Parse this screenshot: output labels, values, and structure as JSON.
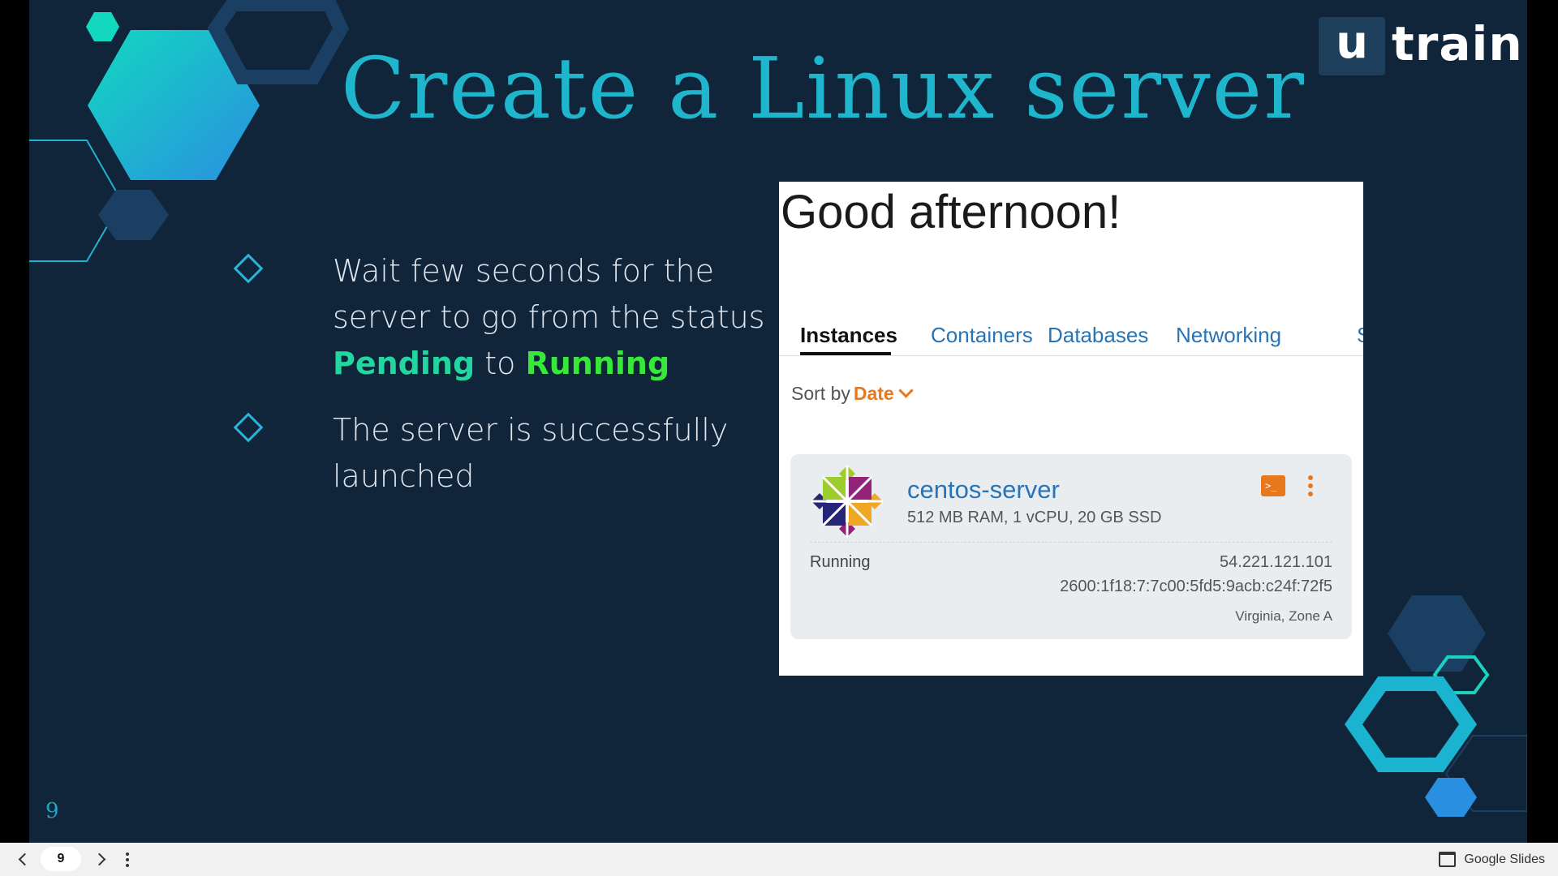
{
  "slide": {
    "title": "Create a Linux server",
    "logo": {
      "mark": "u",
      "wordmark": "train"
    },
    "bullets": [
      {
        "before": "Wait few seconds for the server to go from the status ",
        "highlight1": "Pending",
        "middle": " to ",
        "highlight2": "Running"
      },
      {
        "text": "The server is successfully launched"
      }
    ],
    "page_number": "9",
    "colors": {
      "background": "#10253a",
      "title": "#1fb5cc",
      "pending": "#23d6a0",
      "running": "#37e83a"
    }
  },
  "screenshot": {
    "greeting": "Good afternoon!",
    "tabs": [
      "Instances",
      "Containers",
      "Databases",
      "Networking",
      "S"
    ],
    "active_tab": "Instances",
    "sort_label": "Sort by",
    "sort_value": "Date",
    "instance": {
      "name": "centos-server",
      "spec": "512 MB RAM, 1 vCPU, 20 GB SSD",
      "status": "Running",
      "ipv4": "54.221.121.101",
      "ipv6": "2600:1f18:7:7c00:5fd5:9acb:c24f:72f5",
      "zone": "Virginia, Zone A",
      "logo_icon": "centos-logo-icon",
      "terminal_glyph": ">_"
    }
  },
  "toolbar": {
    "page_input": "9",
    "brand": "Google Slides",
    "icons": [
      "chevron-left-icon",
      "chevron-right-icon",
      "more-vert-icon",
      "slides-icon"
    ]
  }
}
